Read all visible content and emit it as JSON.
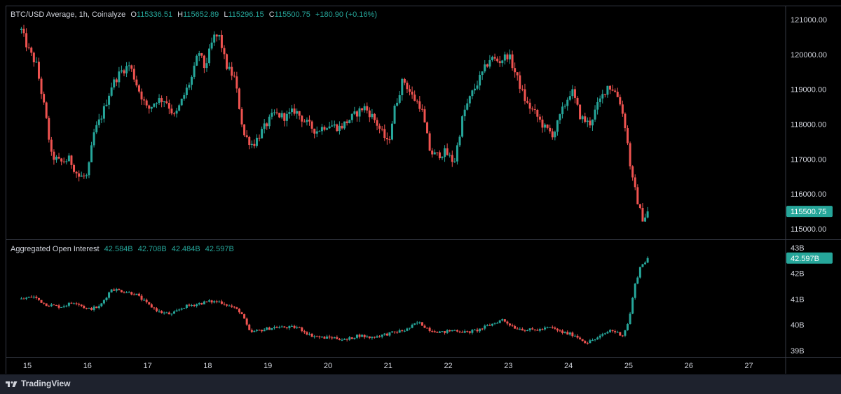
{
  "price_legend": {
    "title": "BTC/USD Average, 1h, Coinalyze",
    "o_label": "O",
    "o": "115336.51",
    "h_label": "H",
    "h": "115652.89",
    "l_label": "L",
    "l": "115296.15",
    "c_label": "C",
    "c": "115500.75",
    "change": "+180.90 (+0.16%)"
  },
  "oi_legend": {
    "title": "Aggregated Open Interest",
    "o": "42.584B",
    "h": "42.708B",
    "l": "42.484B",
    "c": "42.597B"
  },
  "branding": {
    "name": "TradingView"
  },
  "colors": {
    "up": "#26a69a",
    "down": "#ef5350",
    "background": "#000000",
    "grid_line": "#363a45",
    "text": "#d1d4dc",
    "footer": "#1e222d"
  },
  "chart_data": [
    {
      "type": "candlestick",
      "name": "BTC/USD Average, 1h, Coinalyze",
      "y_ticks": [
        "121000.00",
        "120000.00",
        "119000.00",
        "118000.00",
        "117000.00",
        "116000.00",
        "115000.00"
      ],
      "y_tick_values": [
        121000,
        120000,
        119000,
        118000,
        117000,
        116000,
        115000
      ],
      "ylim": [
        114700,
        121400
      ],
      "last_value_label": "115500.75",
      "last_value": 115500.75,
      "path": [
        {
          "d": 14.9,
          "v": 120700
        },
        {
          "d": 15.0,
          "v": 120200
        },
        {
          "d": 15.15,
          "v": 119700
        },
        {
          "d": 15.3,
          "v": 118300
        },
        {
          "d": 15.4,
          "v": 117100
        },
        {
          "d": 15.55,
          "v": 116900
        },
        {
          "d": 15.7,
          "v": 117000
        },
        {
          "d": 15.85,
          "v": 116500
        },
        {
          "d": 16.0,
          "v": 116500
        },
        {
          "d": 16.1,
          "v": 117700
        },
        {
          "d": 16.25,
          "v": 118300
        },
        {
          "d": 16.4,
          "v": 119100
        },
        {
          "d": 16.55,
          "v": 119500
        },
        {
          "d": 16.7,
          "v": 119700
        },
        {
          "d": 16.85,
          "v": 119000
        },
        {
          "d": 17.0,
          "v": 118400
        },
        {
          "d": 17.15,
          "v": 118700
        },
        {
          "d": 17.3,
          "v": 118700
        },
        {
          "d": 17.45,
          "v": 118200
        },
        {
          "d": 17.6,
          "v": 118800
        },
        {
          "d": 17.75,
          "v": 119400
        },
        {
          "d": 17.85,
          "v": 120100
        },
        {
          "d": 17.95,
          "v": 119600
        },
        {
          "d": 18.1,
          "v": 120500
        },
        {
          "d": 18.2,
          "v": 120500
        },
        {
          "d": 18.3,
          "v": 119700
        },
        {
          "d": 18.45,
          "v": 119300
        },
        {
          "d": 18.6,
          "v": 117700
        },
        {
          "d": 18.75,
          "v": 117400
        },
        {
          "d": 18.9,
          "v": 117800
        },
        {
          "d": 19.1,
          "v": 118300
        },
        {
          "d": 19.3,
          "v": 118200
        },
        {
          "d": 19.45,
          "v": 118400
        },
        {
          "d": 19.6,
          "v": 118100
        },
        {
          "d": 19.8,
          "v": 117800
        },
        {
          "d": 20.0,
          "v": 118000
        },
        {
          "d": 20.2,
          "v": 117900
        },
        {
          "d": 20.4,
          "v": 118200
        },
        {
          "d": 20.6,
          "v": 118500
        },
        {
          "d": 20.75,
          "v": 118200
        },
        {
          "d": 20.95,
          "v": 117600
        },
        {
          "d": 21.0,
          "v": 117400
        },
        {
          "d": 21.1,
          "v": 118400
        },
        {
          "d": 21.25,
          "v": 119300
        },
        {
          "d": 21.4,
          "v": 118800
        },
        {
          "d": 21.55,
          "v": 118500
        },
        {
          "d": 21.7,
          "v": 117200
        },
        {
          "d": 21.8,
          "v": 117100
        },
        {
          "d": 21.95,
          "v": 117200
        },
        {
          "d": 22.1,
          "v": 116900
        },
        {
          "d": 22.25,
          "v": 118300
        },
        {
          "d": 22.4,
          "v": 118900
        },
        {
          "d": 22.55,
          "v": 119400
        },
        {
          "d": 22.7,
          "v": 119900
        },
        {
          "d": 22.85,
          "v": 119800
        },
        {
          "d": 23.0,
          "v": 120000
        },
        {
          "d": 23.15,
          "v": 119300
        },
        {
          "d": 23.3,
          "v": 118600
        },
        {
          "d": 23.45,
          "v": 118300
        },
        {
          "d": 23.6,
          "v": 117900
        },
        {
          "d": 23.75,
          "v": 117700
        },
        {
          "d": 23.9,
          "v": 118400
        },
        {
          "d": 24.05,
          "v": 119000
        },
        {
          "d": 24.2,
          "v": 118200
        },
        {
          "d": 24.35,
          "v": 118000
        },
        {
          "d": 24.5,
          "v": 118600
        },
        {
          "d": 24.65,
          "v": 119100
        },
        {
          "d": 24.75,
          "v": 119000
        },
        {
          "d": 24.85,
          "v": 118700
        },
        {
          "d": 24.95,
          "v": 117900
        },
        {
          "d": 25.05,
          "v": 116500
        },
        {
          "d": 25.15,
          "v": 115800
        },
        {
          "d": 25.22,
          "v": 115300
        },
        {
          "d": 25.3,
          "v": 115400
        },
        {
          "d": 25.34,
          "v": 115500
        }
      ]
    },
    {
      "type": "candlestick",
      "name": "Aggregated Open Interest",
      "y_ticks": [
        "43B",
        "42B",
        "41B",
        "40B",
        "39B"
      ],
      "y_tick_values": [
        43,
        42,
        41,
        40,
        39
      ],
      "ylim": [
        38.75,
        43.3
      ],
      "last_value_label": "42.597B",
      "last_value": 42.597,
      "path": [
        {
          "d": 14.9,
          "v": 41.0
        },
        {
          "d": 15.1,
          "v": 41.1
        },
        {
          "d": 15.3,
          "v": 40.8
        },
        {
          "d": 15.55,
          "v": 40.7
        },
        {
          "d": 15.8,
          "v": 40.9
        },
        {
          "d": 16.0,
          "v": 40.6
        },
        {
          "d": 16.2,
          "v": 40.7
        },
        {
          "d": 16.4,
          "v": 41.4
        },
        {
          "d": 16.6,
          "v": 41.3
        },
        {
          "d": 16.8,
          "v": 41.2
        },
        {
          "d": 17.0,
          "v": 40.8
        },
        {
          "d": 17.2,
          "v": 40.5
        },
        {
          "d": 17.4,
          "v": 40.4
        },
        {
          "d": 17.6,
          "v": 40.7
        },
        {
          "d": 17.8,
          "v": 40.8
        },
        {
          "d": 18.0,
          "v": 40.9
        },
        {
          "d": 18.2,
          "v": 40.9
        },
        {
          "d": 18.4,
          "v": 40.7
        },
        {
          "d": 18.55,
          "v": 40.5
        },
        {
          "d": 18.7,
          "v": 39.7
        },
        {
          "d": 18.9,
          "v": 39.8
        },
        {
          "d": 19.1,
          "v": 39.9
        },
        {
          "d": 19.3,
          "v": 39.9
        },
        {
          "d": 19.5,
          "v": 39.9
        },
        {
          "d": 19.7,
          "v": 39.6
        },
        {
          "d": 19.9,
          "v": 39.5
        },
        {
          "d": 20.1,
          "v": 39.5
        },
        {
          "d": 20.3,
          "v": 39.4
        },
        {
          "d": 20.5,
          "v": 39.6
        },
        {
          "d": 20.7,
          "v": 39.5
        },
        {
          "d": 20.9,
          "v": 39.6
        },
        {
          "d": 21.1,
          "v": 39.7
        },
        {
          "d": 21.3,
          "v": 39.8
        },
        {
          "d": 21.5,
          "v": 40.1
        },
        {
          "d": 21.7,
          "v": 39.8
        },
        {
          "d": 21.9,
          "v": 39.7
        },
        {
          "d": 22.1,
          "v": 39.8
        },
        {
          "d": 22.3,
          "v": 39.7
        },
        {
          "d": 22.5,
          "v": 39.8
        },
        {
          "d": 22.7,
          "v": 40.0
        },
        {
          "d": 22.9,
          "v": 40.2
        },
        {
          "d": 23.1,
          "v": 39.9
        },
        {
          "d": 23.3,
          "v": 39.8
        },
        {
          "d": 23.5,
          "v": 39.8
        },
        {
          "d": 23.7,
          "v": 39.9
        },
        {
          "d": 23.9,
          "v": 39.7
        },
        {
          "d": 24.1,
          "v": 39.6
        },
        {
          "d": 24.3,
          "v": 39.3
        },
        {
          "d": 24.5,
          "v": 39.5
        },
        {
          "d": 24.7,
          "v": 39.8
        },
        {
          "d": 24.9,
          "v": 39.6
        },
        {
          "d": 25.0,
          "v": 40.1
        },
        {
          "d": 25.1,
          "v": 41.5
        },
        {
          "d": 25.2,
          "v": 42.3
        },
        {
          "d": 25.34,
          "v": 42.6
        }
      ]
    }
  ],
  "x_axis": {
    "ticks": [
      "15",
      "16",
      "17",
      "18",
      "19",
      "20",
      "21",
      "22",
      "23",
      "24",
      "25",
      "26",
      "27"
    ],
    "tick_values": [
      15,
      16,
      17,
      18,
      19,
      20,
      21,
      22,
      23,
      24,
      25,
      26,
      27
    ],
    "xlim": [
      14.65,
      27.6
    ]
  }
}
